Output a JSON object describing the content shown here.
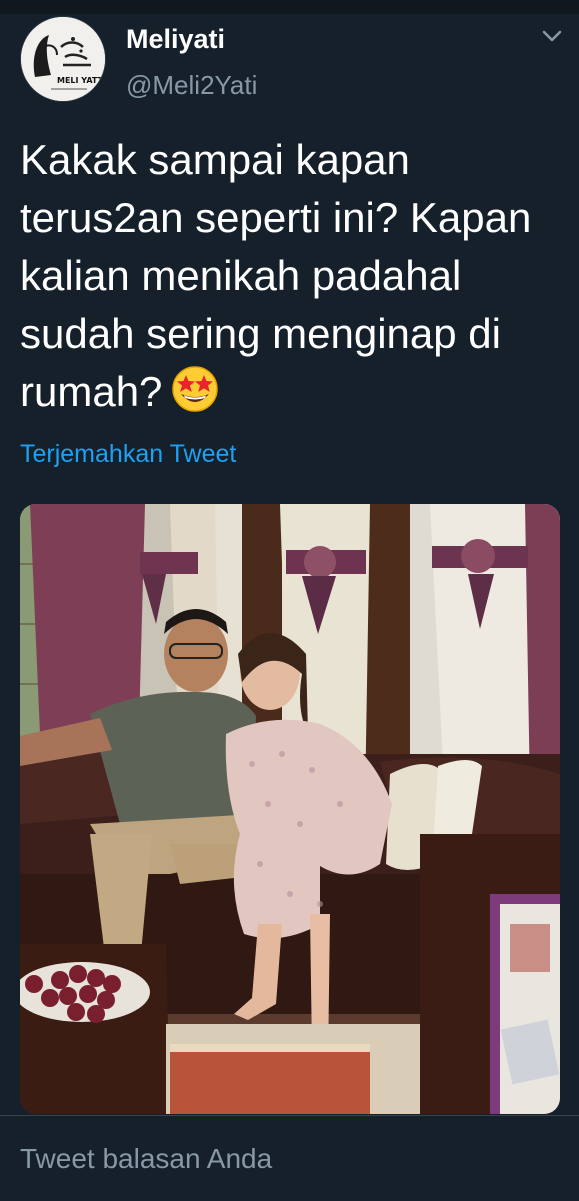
{
  "tweet": {
    "author_name": "Meliyati",
    "author_handle": "@Meli2Yati",
    "avatar_text": "MELI YATT",
    "text": "Kakak sampai kapan terus2an seperti ini? Kapan kalian menikah padahal sudah sering menginap di rumah?",
    "emoji": "star-struck",
    "translate_label": "Terjemahkan Tweet"
  },
  "media": {
    "description_icon": "photo"
  },
  "reply": {
    "placeholder": "Tweet balasan Anda"
  },
  "colors": {
    "background": "#15202b",
    "link": "#1da1f2",
    "secondary_text": "#8899a6",
    "divider": "#38444d"
  }
}
